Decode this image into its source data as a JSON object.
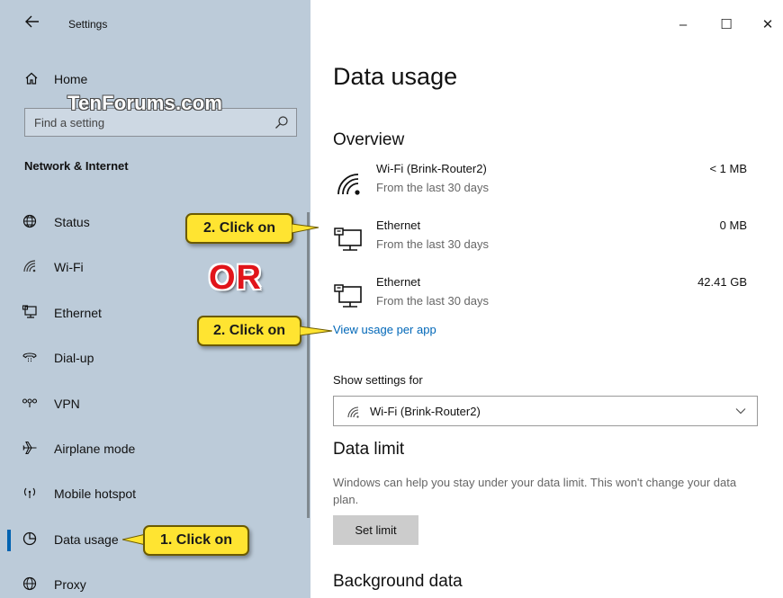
{
  "window": {
    "title": "Settings",
    "controls": {
      "minimize": "–",
      "maximize": "☐",
      "close": "✕"
    }
  },
  "sidebar": {
    "home_label": "Home",
    "watermark": "TenForums.com",
    "search": {
      "placeholder": "Find a setting",
      "value": ""
    },
    "section_title": "Network & Internet",
    "items": [
      {
        "label": "Status",
        "icon": "globe-status-icon",
        "active": false
      },
      {
        "label": "Wi-Fi",
        "icon": "wifi-icon",
        "active": false
      },
      {
        "label": "Ethernet",
        "icon": "ethernet-icon",
        "active": false
      },
      {
        "label": "Dial-up",
        "icon": "dialup-icon",
        "active": false
      },
      {
        "label": "VPN",
        "icon": "vpn-icon",
        "active": false
      },
      {
        "label": "Airplane mode",
        "icon": "airplane-icon",
        "active": false
      },
      {
        "label": "Mobile hotspot",
        "icon": "hotspot-icon",
        "active": false
      },
      {
        "label": "Data usage",
        "icon": "data-usage-icon",
        "active": true
      },
      {
        "label": "Proxy",
        "icon": "globe-icon",
        "active": false
      }
    ]
  },
  "main": {
    "title": "Data usage",
    "overview_heading": "Overview",
    "usage_rows": [
      {
        "name": "Wi-Fi (Brink-Router2)",
        "sub": "From the last 30 days",
        "amount": "< 1 MB",
        "icon": "wifi-icon"
      },
      {
        "name": "Ethernet",
        "sub": "From the last 30 days",
        "amount": "0 MB",
        "icon": "ethernet-icon"
      },
      {
        "name": "Ethernet",
        "sub": "From the last 30 days",
        "amount": "42.41 GB",
        "icon": "ethernet-icon"
      }
    ],
    "view_usage_link": "View usage per app",
    "show_settings_label": "Show settings for",
    "show_settings_value": "Wi-Fi (Brink-Router2)",
    "data_limit_heading": "Data limit",
    "data_limit_desc": "Windows can help you stay under your data limit. This won't change your data plan.",
    "set_limit_button": "Set limit",
    "background_data_heading": "Background data"
  },
  "annotations": {
    "callout_1": "1. Click on",
    "callout_2a": "2. Click on",
    "callout_2b": "2. Click on",
    "or": "OR"
  },
  "colors": {
    "sidebar_bg": "#bccbd9",
    "accent": "#0063b1",
    "link": "#0067b8",
    "callout": "#ffe431",
    "or_red": "#e1141a"
  }
}
